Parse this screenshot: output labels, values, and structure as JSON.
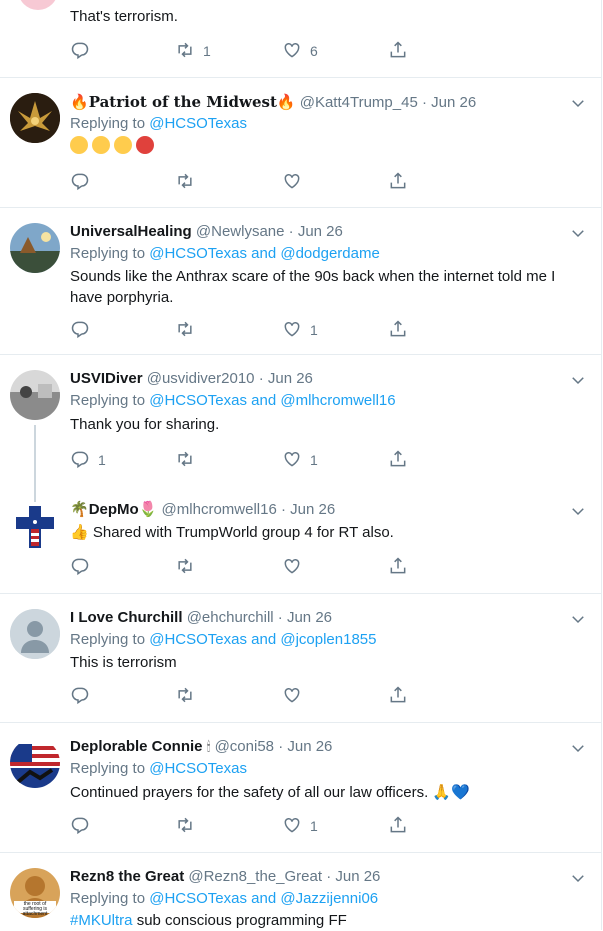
{
  "top_tweet": {
    "text": "That's terrorism.",
    "replies": "",
    "retweets": "1",
    "likes": "6"
  },
  "tweets": [
    {
      "display_name": "Patriot of the Midwest",
      "handle": "@Katt4Trump_45",
      "time": "Jun 26",
      "replying_label": "Replying to",
      "replying_to": "@HCSOTexas",
      "replying_and": "",
      "replying_to_2": "",
      "text": "",
      "replies": "",
      "retweets": "",
      "likes": ""
    },
    {
      "display_name": "UniversalHealing",
      "handle": "@Newlysane",
      "time": "Jun 26",
      "replying_label": "Replying to",
      "replying_to": "@HCSOTexas",
      "replying_and": "and",
      "replying_to_2": "@dodgerdame",
      "text": "Sounds like the Anthrax scare of the 90s back when the internet told me I have porphyria.",
      "replies": "",
      "retweets": "",
      "likes": "1"
    },
    {
      "display_name": "USVIDiver",
      "handle": "@usvidiver2010",
      "time": "Jun 26",
      "replying_label": "Replying to",
      "replying_to": "@HCSOTexas",
      "replying_and": "and",
      "replying_to_2": "@mlhcromwell16",
      "text": "Thank you for sharing.",
      "replies": "1",
      "retweets": "",
      "likes": "1"
    },
    {
      "display_name": "DepMo",
      "handle": "@mlhcromwell16",
      "time": "Jun 26",
      "text": "Shared with TrumpWorld group 4 for RT also.",
      "replies": "",
      "retweets": "",
      "likes": ""
    },
    {
      "display_name": "I Love Churchill",
      "handle": "@ehchurchill",
      "time": "Jun 26",
      "replying_label": "Replying to",
      "replying_to": "@HCSOTexas",
      "replying_and": "and",
      "replying_to_2": "@jcoplen1855",
      "text": "This is terrorism",
      "replies": "",
      "retweets": "",
      "likes": ""
    },
    {
      "display_name": "Deplorable Connie",
      "handle": "@coni58",
      "time": "Jun 26",
      "replying_label": "Replying to",
      "replying_to": "@HCSOTexas",
      "replying_and": "",
      "replying_to_2": "",
      "text": "Continued prayers for the safety of all our law officers.",
      "replies": "",
      "retweets": "",
      "likes": "1"
    },
    {
      "display_name": "Rezn8 the Great",
      "handle": "@Rezn8_the_Great",
      "time": "Jun 26",
      "replying_label": "Replying to",
      "replying_to": "@HCSOTexas",
      "replying_and": "and",
      "replying_to_2": "@Jazzijenni06",
      "hashtag": "#MKUltra",
      "text": "sub conscious programming FF",
      "avatar_text": "the root of suffering is attachment"
    }
  ],
  "separator": "·",
  "colors": {
    "link": "#1da1f2",
    "muted": "#657786",
    "border": "#e6ecf0",
    "text": "#14171a"
  }
}
